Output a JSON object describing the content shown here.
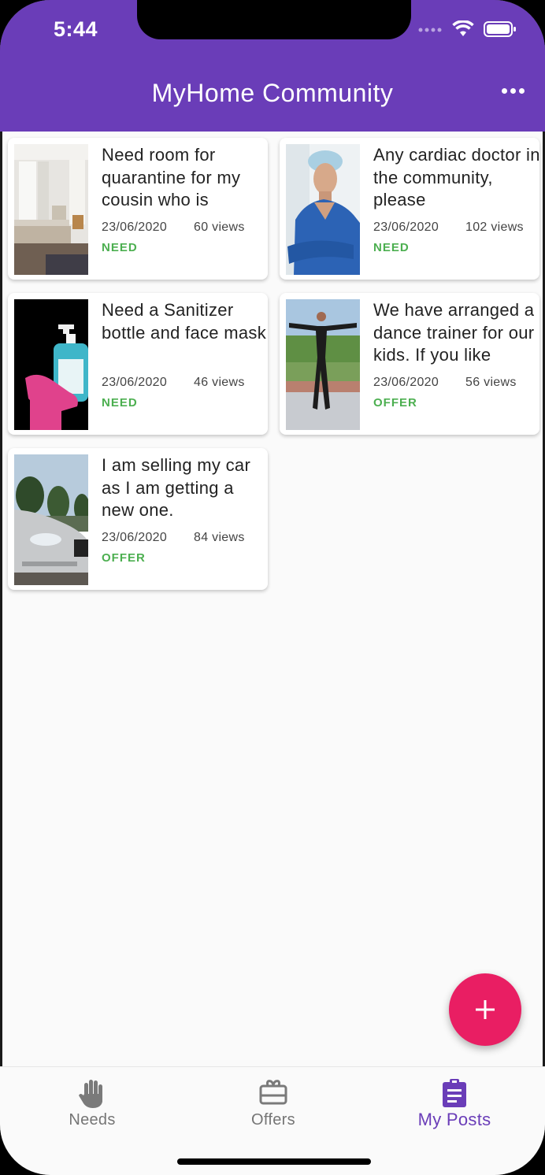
{
  "status_bar": {
    "time": "5:44"
  },
  "app_bar": {
    "title": "MyHome Community",
    "more_icon": "more-horiz-icon"
  },
  "posts": [
    {
      "title": "Need room for quarantine for my cousin who is",
      "date": "23/06/2020",
      "views": "60 views",
      "type": "NEED",
      "image": "bedroom-photo"
    },
    {
      "title": "Any cardiac doctor in the community, please",
      "date": "23/06/2020",
      "views": "102 views",
      "type": "NEED",
      "image": "doctor-photo"
    },
    {
      "title": "Need a Sanitizer bottle and face mask",
      "date": "23/06/2020",
      "views": "46 views",
      "type": "NEED",
      "image": "sanitizer-photo"
    },
    {
      "title": "We have arranged a dance trainer for our kids. If you like",
      "date": "23/06/2020",
      "views": "56 views",
      "type": "OFFER",
      "image": "dance-trainer-photo"
    },
    {
      "title": "I am selling my car as I am getting a new one.",
      "date": "23/06/2020",
      "views": "84 views",
      "type": "OFFER",
      "image": "car-photo"
    }
  ],
  "fab": {
    "icon": "add-icon"
  },
  "bottom_nav": [
    {
      "label": "Needs",
      "icon": "hand-icon",
      "active": false
    },
    {
      "label": "Offers",
      "icon": "gift-card-icon",
      "active": false
    },
    {
      "label": "My Posts",
      "icon": "clipboard-icon",
      "active": true
    }
  ],
  "colors": {
    "primary": "#6a3db8",
    "accent": "#e91e63",
    "tag_green": "#4caf50"
  }
}
